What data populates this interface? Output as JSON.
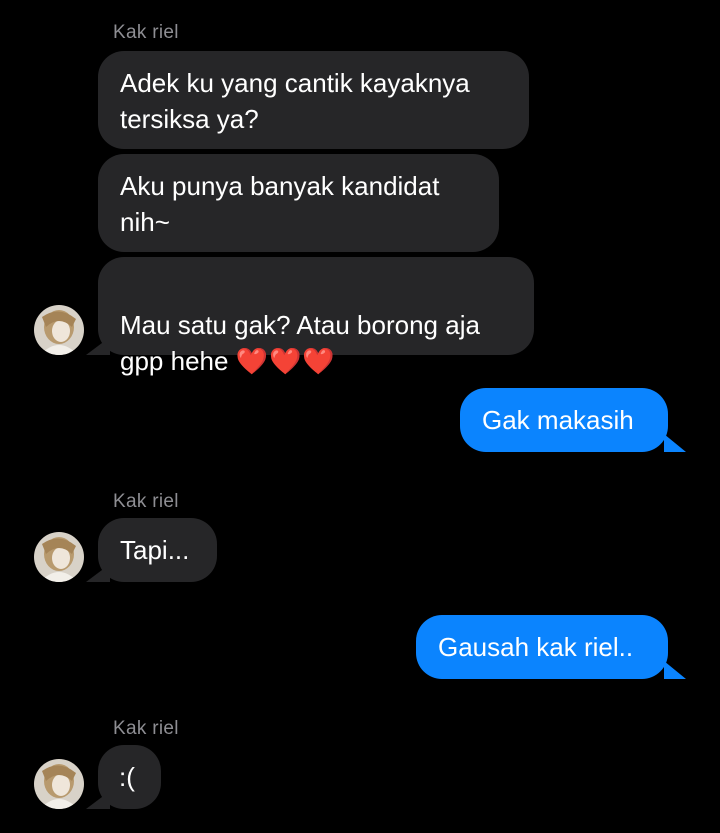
{
  "contact": {
    "name": "Kak riel"
  },
  "messages": [
    {
      "id": "m1",
      "from": "incoming",
      "text": "Adek ku yang cantik kayaknya\ntersiksa ya?"
    },
    {
      "id": "m2",
      "from": "incoming",
      "text": "Aku punya banyak kandidat\nnih~"
    },
    {
      "id": "m3",
      "from": "incoming",
      "text": "Mau satu gak? Atau borong aja\ngpp hehe ",
      "emoji": "❤️❤️❤️"
    },
    {
      "id": "m4",
      "from": "outgoing",
      "text": "Gak makasih"
    },
    {
      "id": "m5",
      "from": "incoming",
      "text": "Tapi..."
    },
    {
      "id": "m6",
      "from": "outgoing",
      "text": "Gausah kak riel.."
    },
    {
      "id": "m7",
      "from": "incoming",
      "text": ":("
    }
  ],
  "colors": {
    "background": "#000000",
    "incoming_bubble": "#262628",
    "outgoing_bubble": "#0b84fe",
    "sender_label": "#8e8e93",
    "heart": "#e5242a"
  },
  "icons": {
    "avatar": "contact-avatar-photo",
    "heart": "red-heart-emoji"
  }
}
